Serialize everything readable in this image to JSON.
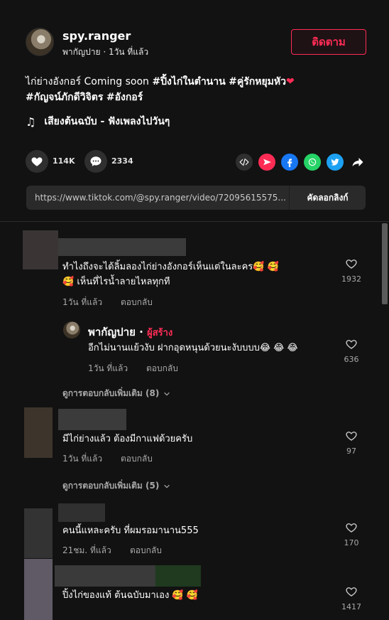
{
  "post": {
    "username": "spy.ranger",
    "subtitle": "พากัญปาย · 1วัน ที่แล้ว",
    "follow_label": "ติดตาม",
    "caption_line1_text": "ไก่ย่างอังกอร์ Coming soon ",
    "caption_tag1": "#ปิ้งไก่ในตำนาน",
    "caption_tag2": "#คู่รักหยุมหัว",
    "caption_heart": "❤",
    "caption_tag3": "#กัญจน์ภักดีวิจิตร",
    "caption_tag4": "#อังกอร์",
    "music_note": "♫",
    "music": "เสียงต้นฉบับ - ฟังเพลงไปวันๆ",
    "likes": "114K",
    "comments": "2334",
    "link_url": "https://www.tiktok.com/@spy.ranger/video/72095615575...",
    "copy_label": "คัดลอกลิงก์"
  },
  "colors": {
    "accent": "#fe2c55",
    "facebook": "#1877f2",
    "whatsapp": "#25d366",
    "twitter": "#1da1f2"
  },
  "comments": [
    {
      "text_line1": "ทำไงถึงจะได้ลิ้มลองไก่ย่างอังกอร์เห็นแต่ในละคร🥰 🥰",
      "text_line2": "🥰 เห็นที่ไรน้ำลายไหลทุกที",
      "time": "1วัน ที่แล้ว",
      "reply_label": "ตอบกลับ",
      "likes": "1932",
      "reply": {
        "name": "พากัญปาย",
        "dot": "·",
        "badge": "ผู้สร้าง",
        "text": "อีกไม่นานแย้วงับ ฝากอุดหนุนด้วยนะงับบบบ😂 😂 😂",
        "time": "1วัน ที่แล้ว",
        "reply_label": "ตอบกลับ",
        "likes": "636"
      },
      "more": "ดูการตอบกลับเพิ่มเติม (8)"
    },
    {
      "text_line1": "มีไก่ย่างแล้ว ต้องมีกาแฟด้วยครับ",
      "time": "1วัน ที่แล้ว",
      "reply_label": "ตอบกลับ",
      "likes": "97",
      "more": "ดูการตอบกลับเพิ่มเติม (5)"
    },
    {
      "text_line1": "คนนี้แหละครับ ที่ผมรอมานาน555",
      "time": "21ชม. ที่แล้ว",
      "reply_label": "ตอบกลับ",
      "likes": "170"
    },
    {
      "text_line1": "ปิ้งไก่ของแท้ ต้นฉบับมาเอง 🥰 🥰",
      "likes": "1417"
    }
  ]
}
